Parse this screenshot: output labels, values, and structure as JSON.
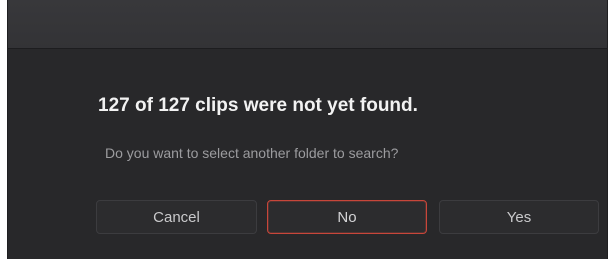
{
  "dialog": {
    "heading": "127 of 127 clips were not yet found.",
    "message": "Do you want to select another folder to search?",
    "buttons": {
      "cancel": "Cancel",
      "no": "No",
      "yes": "Yes"
    },
    "focused_button": "no"
  },
  "colors": {
    "background": "#28282a",
    "titlebar": "#363639",
    "heading_text": "#f2f2f2",
    "message_text": "#9c9c9f",
    "focus_outline": "#c8463a"
  }
}
